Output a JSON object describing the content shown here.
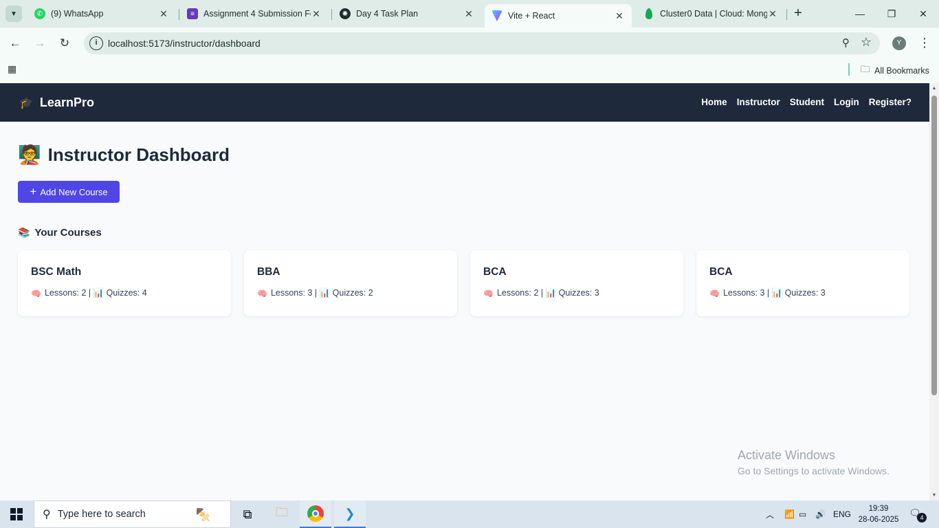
{
  "browser": {
    "tabs": [
      {
        "title": "(9) WhatsApp",
        "icon": "whatsapp-icon",
        "color": "#25d366"
      },
      {
        "title": "Assignment 4 Submission Fo",
        "icon": "forms-icon",
        "color": "#673ab7"
      },
      {
        "title": "Day 4 Task Plan",
        "icon": "chatgpt-icon",
        "color": "#1f2d2a"
      },
      {
        "title": "Vite + React",
        "icon": "vite-icon",
        "color": "#8b5cf6"
      },
      {
        "title": "Cluster0 Data | Cloud: Mong",
        "icon": "mongodb-leaf-icon",
        "color": "#13aa52"
      }
    ],
    "active_tab": 3,
    "url": "localhost:5173/instructor/dashboard",
    "profile_initial": "Y",
    "all_bookmarks": "All Bookmarks"
  },
  "app": {
    "brand": "LearnPro",
    "nav": [
      "Home",
      "Instructor",
      "Student",
      "Login",
      "Register?"
    ],
    "page_title": "Instructor Dashboard",
    "add_button": "Add New Course",
    "section_title": "Your Courses",
    "courses": [
      {
        "name": "BSC Math",
        "meta": "Lessons: 2 | 📊 Quizzes: 4"
      },
      {
        "name": "BBA",
        "meta": "Lessons: 3 | 📊 Quizzes: 2"
      },
      {
        "name": "BCA",
        "meta": "Lessons: 2 | 📊 Quizzes: 3"
      },
      {
        "name": "BCA",
        "meta": "Lessons: 3 | 📊 Quizzes: 3"
      }
    ]
  },
  "watermark": {
    "line1": "Activate Windows",
    "line2": "Go to Settings to activate Windows."
  },
  "taskbar": {
    "search_placeholder": "Type here to search",
    "language": "ENG",
    "time": "19:39",
    "date": "28-06-2025",
    "notification_count": "4"
  }
}
